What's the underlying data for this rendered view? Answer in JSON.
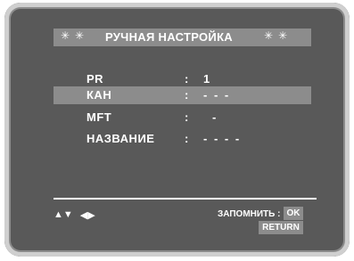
{
  "menu": {
    "title_star": "✳",
    "title": "РУЧНАЯ НАСТРОЙКА"
  },
  "rows": [
    {
      "label": "PR",
      "colon": ":",
      "value": "1"
    },
    {
      "label": "КАН",
      "colon": ":",
      "value": "- - -"
    },
    {
      "label": "MFT",
      "colon": ":",
      "value": "-"
    },
    {
      "label": "НАЗВАНИЕ",
      "colon": ":",
      "value": "- - - -"
    }
  ],
  "highlighted_row": 1,
  "footer": {
    "nav_updown": "▲▼",
    "nav_leftright": "◀▶",
    "save_label": "ЗАПОМНИТЬ :",
    "ok_label": "OK",
    "return_label": "RETURN"
  },
  "colors": {
    "background": "#595959",
    "highlight": "#8c8c8c",
    "text": "#ffffff"
  }
}
